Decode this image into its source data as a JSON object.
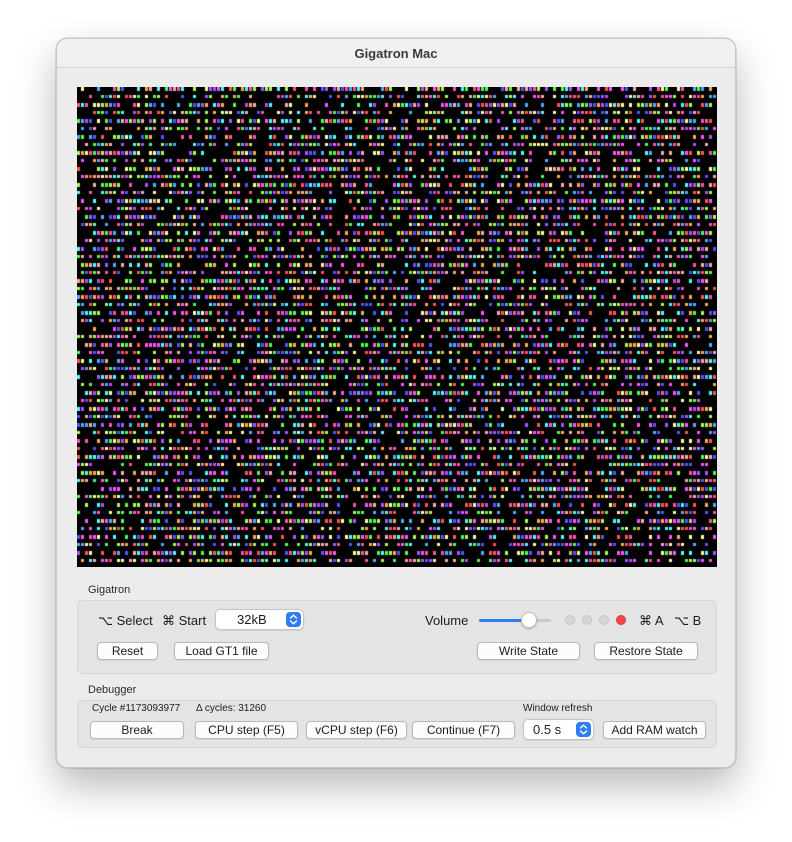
{
  "window": {
    "title": "Gigatron Mac"
  },
  "screen": {
    "background": "#000000",
    "palette": [
      "#ff5555",
      "#55ff55",
      "#5555ff",
      "#ffaa55",
      "#ff55ff",
      "#55ffff",
      "#aaff55",
      "#ffffaa",
      "#aa55ff",
      "#ff55aa",
      "#55aaff",
      "#ffaaaa"
    ]
  },
  "gigatron": {
    "section_label": "Gigatron",
    "select_label": "⌥ Select",
    "start_label": "⌘ Start",
    "memory_value": "32kB",
    "volume_label": "Volume",
    "volume_level": 0.7,
    "leds": [
      {
        "on": false,
        "color": "#d6d6d6"
      },
      {
        "on": false,
        "color": "#d6d6d6"
      },
      {
        "on": false,
        "color": "#d6d6d6"
      },
      {
        "on": true,
        "color": "#f24a4a"
      }
    ],
    "a_label": "⌘ A",
    "b_label": "⌥ B",
    "reset_label": "Reset",
    "load_label": "Load GT1 file",
    "write_state_label": "Write State",
    "restore_state_label": "Restore State"
  },
  "debugger": {
    "section_label": "Debugger",
    "cycle_text": "Cycle #1173093977",
    "delta_cycles_text": "Δ cycles: 31260",
    "window_refresh_label": "Window refresh",
    "refresh_value": "0.5 s",
    "break_label": "Break",
    "cpu_step_label": "CPU step (F5)",
    "vcpu_step_label": "vCPU step (F6)",
    "continue_label": "Continue (F7)",
    "add_ram_watch_label": "Add RAM watch"
  },
  "colors": {
    "accent": "#2e7cf6"
  }
}
